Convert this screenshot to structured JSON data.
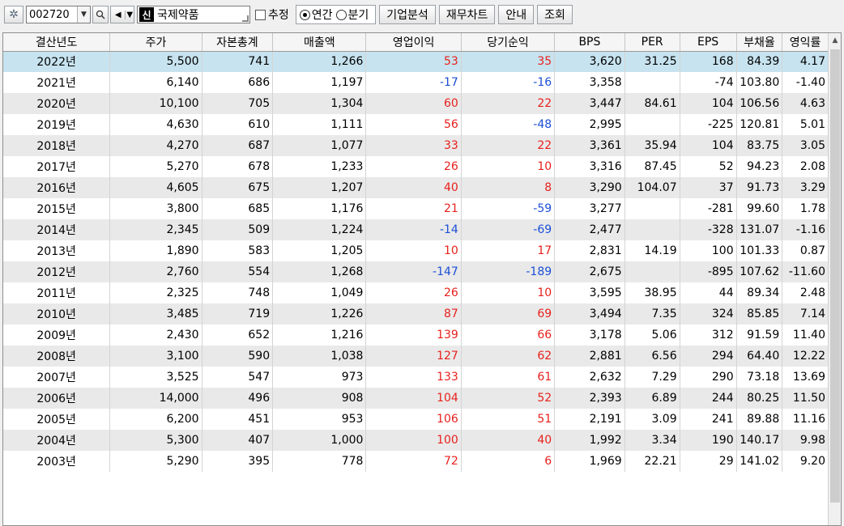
{
  "toolbar": {
    "code": "002720",
    "badge": "신",
    "company": "국제약품",
    "estimate_label": "추정",
    "annual_label": "연간",
    "quarter_label": "분기",
    "buttons": [
      "기업분석",
      "재무차트",
      "안내",
      "조회"
    ]
  },
  "table": {
    "headers": [
      "결산년도",
      "주가",
      "자본총계",
      "매출액",
      "영업이익",
      "당기순익",
      "BPS",
      "PER",
      "EPS",
      "부채율",
      "영익률"
    ],
    "rows": [
      [
        "2022년",
        "5,500",
        "741",
        "1,266",
        "53",
        "35",
        "3,620",
        "31.25",
        "168",
        "84.39",
        "4.17"
      ],
      [
        "2021년",
        "6,140",
        "686",
        "1,197",
        "-17",
        "-16",
        "3,358",
        "",
        "-74",
        "103.80",
        "-1.40"
      ],
      [
        "2020년",
        "10,100",
        "705",
        "1,304",
        "60",
        "22",
        "3,447",
        "84.61",
        "104",
        "106.56",
        "4.63"
      ],
      [
        "2019년",
        "4,630",
        "610",
        "1,111",
        "56",
        "-48",
        "2,995",
        "",
        "-225",
        "120.81",
        "5.01"
      ],
      [
        "2018년",
        "4,270",
        "687",
        "1,077",
        "33",
        "22",
        "3,361",
        "35.94",
        "104",
        "83.75",
        "3.05"
      ],
      [
        "2017년",
        "5,270",
        "678",
        "1,233",
        "26",
        "10",
        "3,316",
        "87.45",
        "52",
        "94.23",
        "2.08"
      ],
      [
        "2016년",
        "4,605",
        "675",
        "1,207",
        "40",
        "8",
        "3,290",
        "104.07",
        "37",
        "91.73",
        "3.29"
      ],
      [
        "2015년",
        "3,800",
        "685",
        "1,176",
        "21",
        "-59",
        "3,277",
        "",
        "-281",
        "99.60",
        "1.78"
      ],
      [
        "2014년",
        "2,345",
        "509",
        "1,224",
        "-14",
        "-69",
        "2,477",
        "",
        "-328",
        "131.07",
        "-1.16"
      ],
      [
        "2013년",
        "1,890",
        "583",
        "1,205",
        "10",
        "17",
        "2,831",
        "14.19",
        "100",
        "101.33",
        "0.87"
      ],
      [
        "2012년",
        "2,760",
        "554",
        "1,268",
        "-147",
        "-189",
        "2,675",
        "",
        "-895",
        "107.62",
        "-11.60"
      ],
      [
        "2011년",
        "2,325",
        "748",
        "1,049",
        "26",
        "10",
        "3,595",
        "38.95",
        "44",
        "89.34",
        "2.48"
      ],
      [
        "2010년",
        "3,485",
        "719",
        "1,226",
        "87",
        "69",
        "3,494",
        "7.35",
        "324",
        "85.85",
        "7.14"
      ],
      [
        "2009년",
        "2,430",
        "652",
        "1,216",
        "139",
        "66",
        "3,178",
        "5.06",
        "312",
        "91.59",
        "11.40"
      ],
      [
        "2008년",
        "3,100",
        "590",
        "1,038",
        "127",
        "62",
        "2,881",
        "6.56",
        "294",
        "64.40",
        "12.22"
      ],
      [
        "2007년",
        "3,525",
        "547",
        "973",
        "133",
        "61",
        "2,632",
        "7.29",
        "290",
        "73.18",
        "13.69"
      ],
      [
        "2006년",
        "14,000",
        "496",
        "908",
        "104",
        "52",
        "2,393",
        "6.89",
        "244",
        "80.25",
        "11.50"
      ],
      [
        "2005년",
        "6,200",
        "451",
        "953",
        "106",
        "51",
        "2,191",
        "3.09",
        "241",
        "89.88",
        "11.16"
      ],
      [
        "2004년",
        "5,300",
        "407",
        "1,000",
        "100",
        "40",
        "1,992",
        "3.34",
        "190",
        "140.17",
        "9.98"
      ],
      [
        "2003년",
        "5,290",
        "395",
        "778",
        "72",
        "6",
        "1,969",
        "22.21",
        "29",
        "141.02",
        "9.20"
      ]
    ]
  },
  "icons": {
    "settings": "gear-icon",
    "dropdown": "chevron-down-icon",
    "search": "search-icon",
    "sound": "speaker-icon",
    "scroll_up": "chevron-up-icon"
  },
  "colors": {
    "positive": "#e8211d",
    "negative": "#1c4fd6",
    "selected_row": "#c7e3ef",
    "alt_row": "#e9e9e9"
  }
}
